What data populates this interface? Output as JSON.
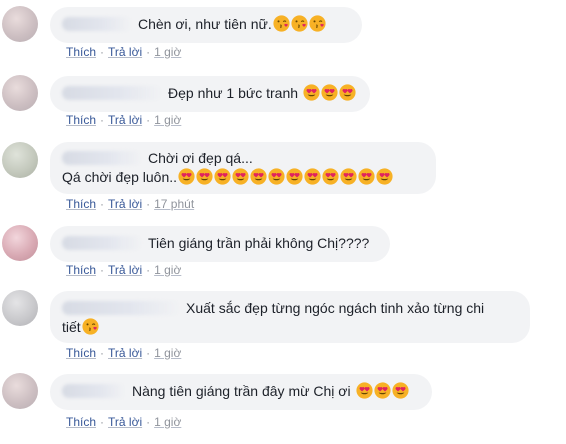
{
  "actions": {
    "like": "Thích",
    "reply": "Trả lời",
    "sep": "·"
  },
  "comments": [
    {
      "text": "Chèn ơi, như tiên nữ.",
      "emoji": "kiss-wink-icon",
      "emoji_count": 3,
      "time": "1 giờ"
    },
    {
      "text": "Đẹp như 1 bức tranh",
      "emoji": "heart-eyes-icon",
      "emoji_count": 3,
      "time": "1 giờ"
    },
    {
      "line1": "Chời ơi đẹp qá...",
      "line2": "Qá chời đẹp luôn..",
      "emoji": "heart-eyes-icon",
      "emoji_count": 12,
      "time": "17 phút"
    },
    {
      "text": "Tiên giáng trần phải không Chị????",
      "time": "1 giờ"
    },
    {
      "line1": "Xuất sắc đẹp từng ngóc ngách tinh xảo từng chi",
      "line2": "tiết",
      "emoji": "kiss-wink-icon",
      "emoji_count": 1,
      "time": "1 giờ"
    },
    {
      "text": "Nàng tiên giáng trần đây mừ Chị ơi",
      "emoji": "heart-eyes-icon",
      "emoji_count": 3,
      "time": "1 giờ"
    }
  ],
  "colors": {
    "link": "#385898",
    "meta": "#90949c",
    "bubble": "#f2f3f5",
    "text": "#1d2129",
    "emoji": "#f7b125"
  }
}
